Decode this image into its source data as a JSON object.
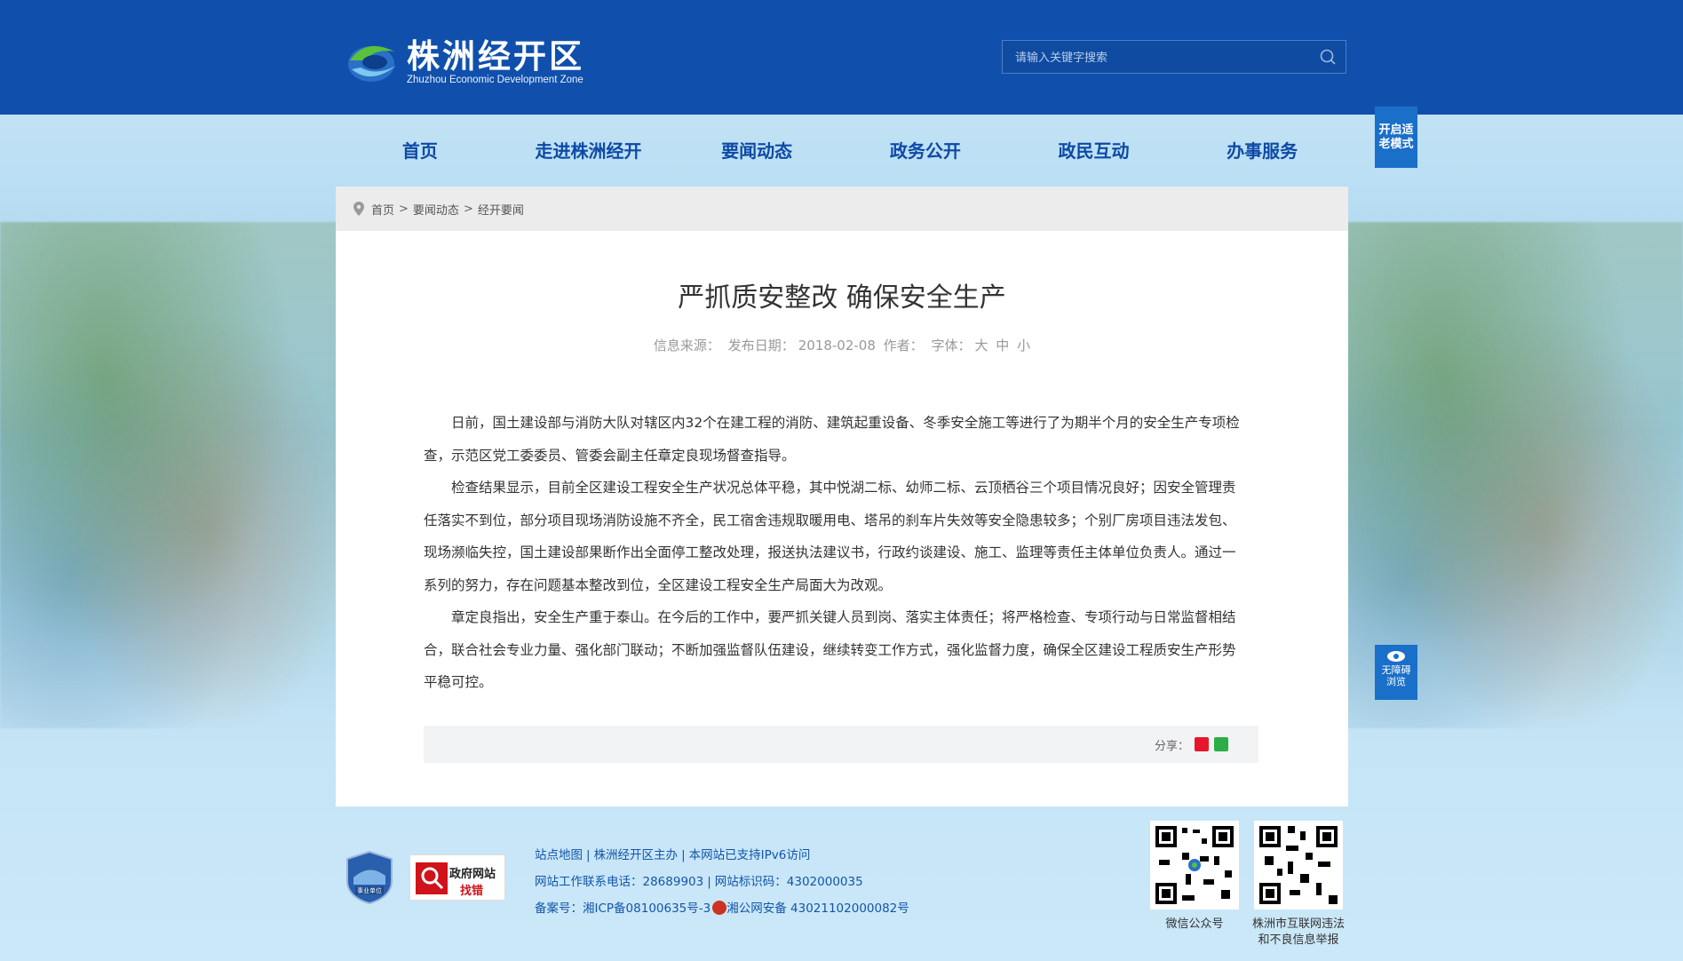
{
  "colors": {
    "brand_blue": "#1050ac",
    "nav_text": "#0d4aa6",
    "side_button": "#1a6fc9",
    "link": "#1355a8"
  },
  "header": {
    "logo_cn": "株洲经开区",
    "logo_en": "Zhuzhou Economic Development Zone",
    "search_placeholder": "请输入关键字搜索"
  },
  "nav": {
    "items": [
      {
        "label": "首页"
      },
      {
        "label": "走进株洲经开"
      },
      {
        "label": "要闻动态"
      },
      {
        "label": "政务公开"
      },
      {
        "label": "政民互动"
      },
      {
        "label": "办事服务"
      }
    ]
  },
  "side": {
    "elder_mode": "开启适老模式",
    "accessibility_1": "无障碍",
    "accessibility_2": "浏览"
  },
  "breadcrumb": [
    "首页",
    "要闻动态",
    "经开要闻"
  ],
  "breadcrumb_sep": ">",
  "article": {
    "title": "严抓质安整改 确保安全生产",
    "meta": {
      "source_label": "信息来源：",
      "date_label": "发布日期：",
      "date": "2018-02-08",
      "author_label": "作者：",
      "font_label": "字体：",
      "font_large": "大",
      "font_medium": "中",
      "font_small": "小"
    },
    "paragraphs": [
      "日前，国土建设部与消防大队对辖区内32个在建工程的消防、建筑起重设备、冬季安全施工等进行了为期半个月的安全生产专项检查，示范区党工委委员、管委会副主任章定良现场督查指导。",
      "检查结果显示，目前全区建设工程安全生产状况总体平稳，其中悦湖二标、幼师二标、云顶栖谷三个项目情况良好；因安全管理责任落实不到位，部分项目现场消防设施不齐全，民工宿舍违规取暖用电、塔吊的刹车片失效等安全隐患较多；个别厂房项目违法发包、现场濒临失控，国土建设部果断作出全面停工整改处理，报送执法建议书，行政约谈建设、施工、监理等责任主体单位负责人。通过一系列的努力，存在问题基本整改到位，全区建设工程安全生产局面大为改观。",
      "章定良指出，安全生产重于泰山。在今后的工作中，要严抓关键人员到岗、落实主体责任；将严格检查、专项行动与日常监督相结合，联合社会专业力量、强化部门联动；不断加强监督队伍建设，继续转变工作方式，强化监督力度，确保全区建设工程质安生产形势平稳可控。"
    ],
    "share_label": "分享："
  },
  "footer": {
    "links": [
      "站点地图",
      "株洲经开区主办",
      "本网站已支持IPv6访问"
    ],
    "phone_label": "网站工作联系电话：",
    "phone": "28689903",
    "site_id_label": "网站标识码：",
    "site_id": "4302000035",
    "icp_label": "备案号：",
    "icp": "湘ICP备08100635号-3",
    "police": "湘公网安备 43021102000082号",
    "badge_unit": "事业单位",
    "gov_badge_1": "政府网站",
    "gov_badge_2": "找错",
    "qr1_caption": "微信公众号",
    "qr2_caption_1": "株洲市互联网违法",
    "qr2_caption_2": "和不良信息举报"
  }
}
